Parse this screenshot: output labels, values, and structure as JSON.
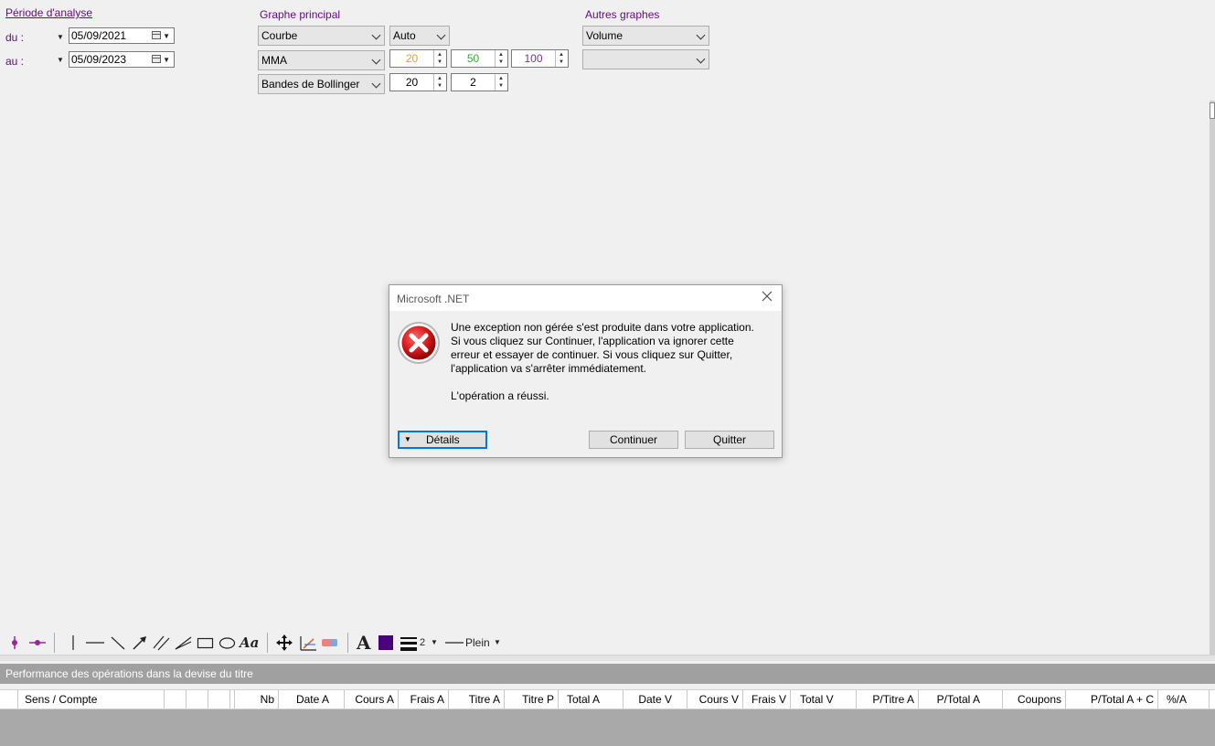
{
  "period": {
    "title": "Période d'analyse",
    "from_label": "du :",
    "to_label": "au :",
    "from_date": "05/09/2021",
    "to_date": "05/09/2023"
  },
  "main_graph": {
    "title": "Graphe principal",
    "type_value": "Courbe",
    "scale_value": "Auto",
    "indicator_value": "MMA",
    "mma_periods": [
      {
        "value": "20",
        "color": "#e8a317"
      },
      {
        "value": "50",
        "color": "#3aa83a"
      },
      {
        "value": "100",
        "color": "#7b2fa8"
      }
    ],
    "bands_value": "Bandes de Bollinger",
    "bands_period": "20",
    "bands_width": "2"
  },
  "other_graphs": {
    "title": "Autres graphes",
    "first_value": "Volume",
    "second_value": ""
  },
  "toolbar": {
    "line_width": "2",
    "line_style": "Plein",
    "text_tool": "Aa",
    "font_tool": "A",
    "icons": [
      "point-marker-icon",
      "line-marker-icon",
      "vertical-line-icon",
      "horizontal-line-icon",
      "diagonal-line-icon",
      "arrow-icon",
      "parallel-lines-icon",
      "channel-icon",
      "rectangle-icon",
      "ellipse-icon",
      "text-icon",
      "move-icon",
      "fibonacci-icon",
      "eraser-icon",
      "font-icon",
      "color-icon",
      "line-width-icon",
      "line-style-icon"
    ]
  },
  "dialog": {
    "title": "Microsoft .NET",
    "message_lines": [
      "Une exception non gérée s'est produite dans votre application.",
      "Si vous cliquez sur Continuer, l'application va ignorer cette",
      "erreur et essayer de continuer. Si vous cliquez sur Quitter,",
      "l'application va s'arrêter immédiatement."
    ],
    "message_detail": "L'opération a réussi.",
    "details_label": "Détails",
    "continue_label": "Continuer",
    "quit_label": "Quitter"
  },
  "performance": {
    "title": "Performance des opérations dans la devise du titre",
    "columns": [
      "",
      "Sens / Compte",
      "",
      "",
      "",
      "",
      "Nb",
      "Date A",
      "Cours A",
      "Frais A",
      "Titre A",
      "Titre P",
      "Total A",
      "Date V",
      "Cours V",
      "Frais V",
      "Total V",
      "P/Titre A",
      "P/Total A",
      "Coupons",
      "P/Total A + C",
      "%/A"
    ]
  },
  "colors": {
    "accent_purple": "#6a0a8a",
    "error_red": "#c8102e",
    "color_swatch": "#4b0082"
  }
}
